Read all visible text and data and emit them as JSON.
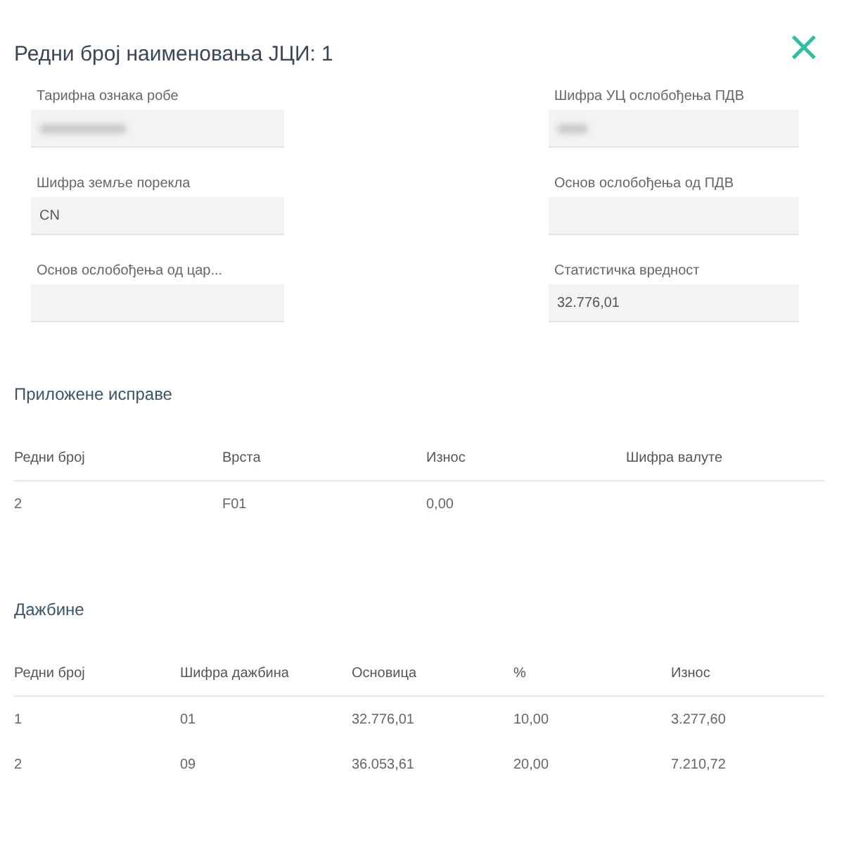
{
  "dialog": {
    "title": "Редни број наименовања ЈЦИ: 1",
    "close": "×"
  },
  "fields": [
    {
      "label": "Тарифна ознака робе",
      "redacted": true
    },
    {
      "label": "Шифра УЦ ослобођења ПДВ",
      "redacted": true
    },
    {
      "label": "Шифра земље порекла",
      "value": "CN",
      "redacted": false
    },
    {
      "label": "Основ ослобођења од ПДВ",
      "redacted": false
    },
    {
      "label": "Основ ослобођења од цар...",
      "redacted": false
    },
    {
      "label": "Статистичка вредност",
      "value": "32.776,01",
      "redacted": false
    }
  ],
  "documents": {
    "title": "Приложене исправе",
    "columns": [
      "Редни број",
      "Врста",
      "Износ",
      "Шифра валуте"
    ],
    "rows": [
      [
        "2",
        "F01",
        "0,00",
        ""
      ]
    ]
  },
  "duties": {
    "title": "Дажбине",
    "columns": [
      "Редни број",
      "Шифра дажбина",
      "Основица",
      "%",
      "Износ"
    ],
    "rows": [
      [
        "1",
        "01",
        "32.776,01",
        "10,00",
        "3.277,60"
      ],
      [
        "2",
        "09",
        "36.053,61",
        "20,00",
        "7.210,72"
      ]
    ]
  }
}
